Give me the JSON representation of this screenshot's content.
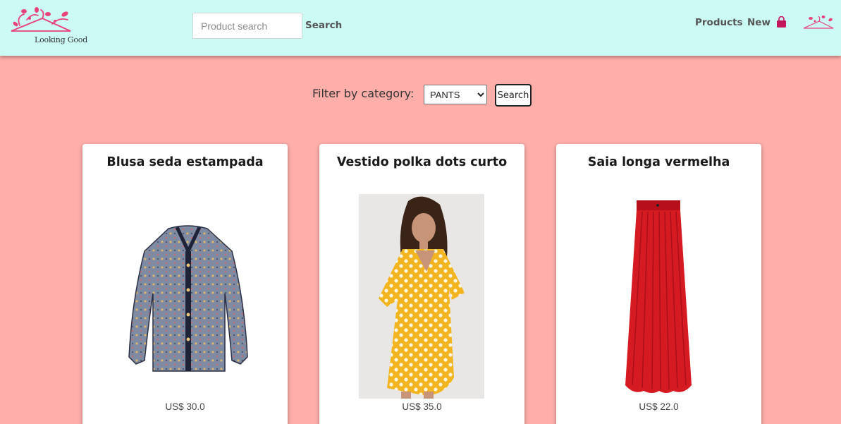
{
  "brand": {
    "name": "Looking Good",
    "accent_color": "#e8417a",
    "header_bg": "#ccfbf6",
    "page_bg": "#ffaeaa"
  },
  "header": {
    "search": {
      "placeholder": "Product search",
      "value": "",
      "button_label": "Search"
    },
    "nav": {
      "products": "Products",
      "new": "New"
    },
    "icons": {
      "cart": "shopping-bag-icon",
      "logo": "hanger-logo-icon"
    }
  },
  "filter": {
    "label": "Filter by category:",
    "selected": "PANTS",
    "button_label": "Search"
  },
  "products": [
    {
      "title": "Blusa seda estampada",
      "price": "US$ 30.0",
      "image": "printed-silk-blouse"
    },
    {
      "title": "Vestido polka dots curto",
      "price": "US$ 35.0",
      "image": "yellow-polka-dot-dress"
    },
    {
      "title": "Saia longa vermelha",
      "price": "US$ 22.0",
      "image": "long-red-pleated-skirt"
    }
  ]
}
